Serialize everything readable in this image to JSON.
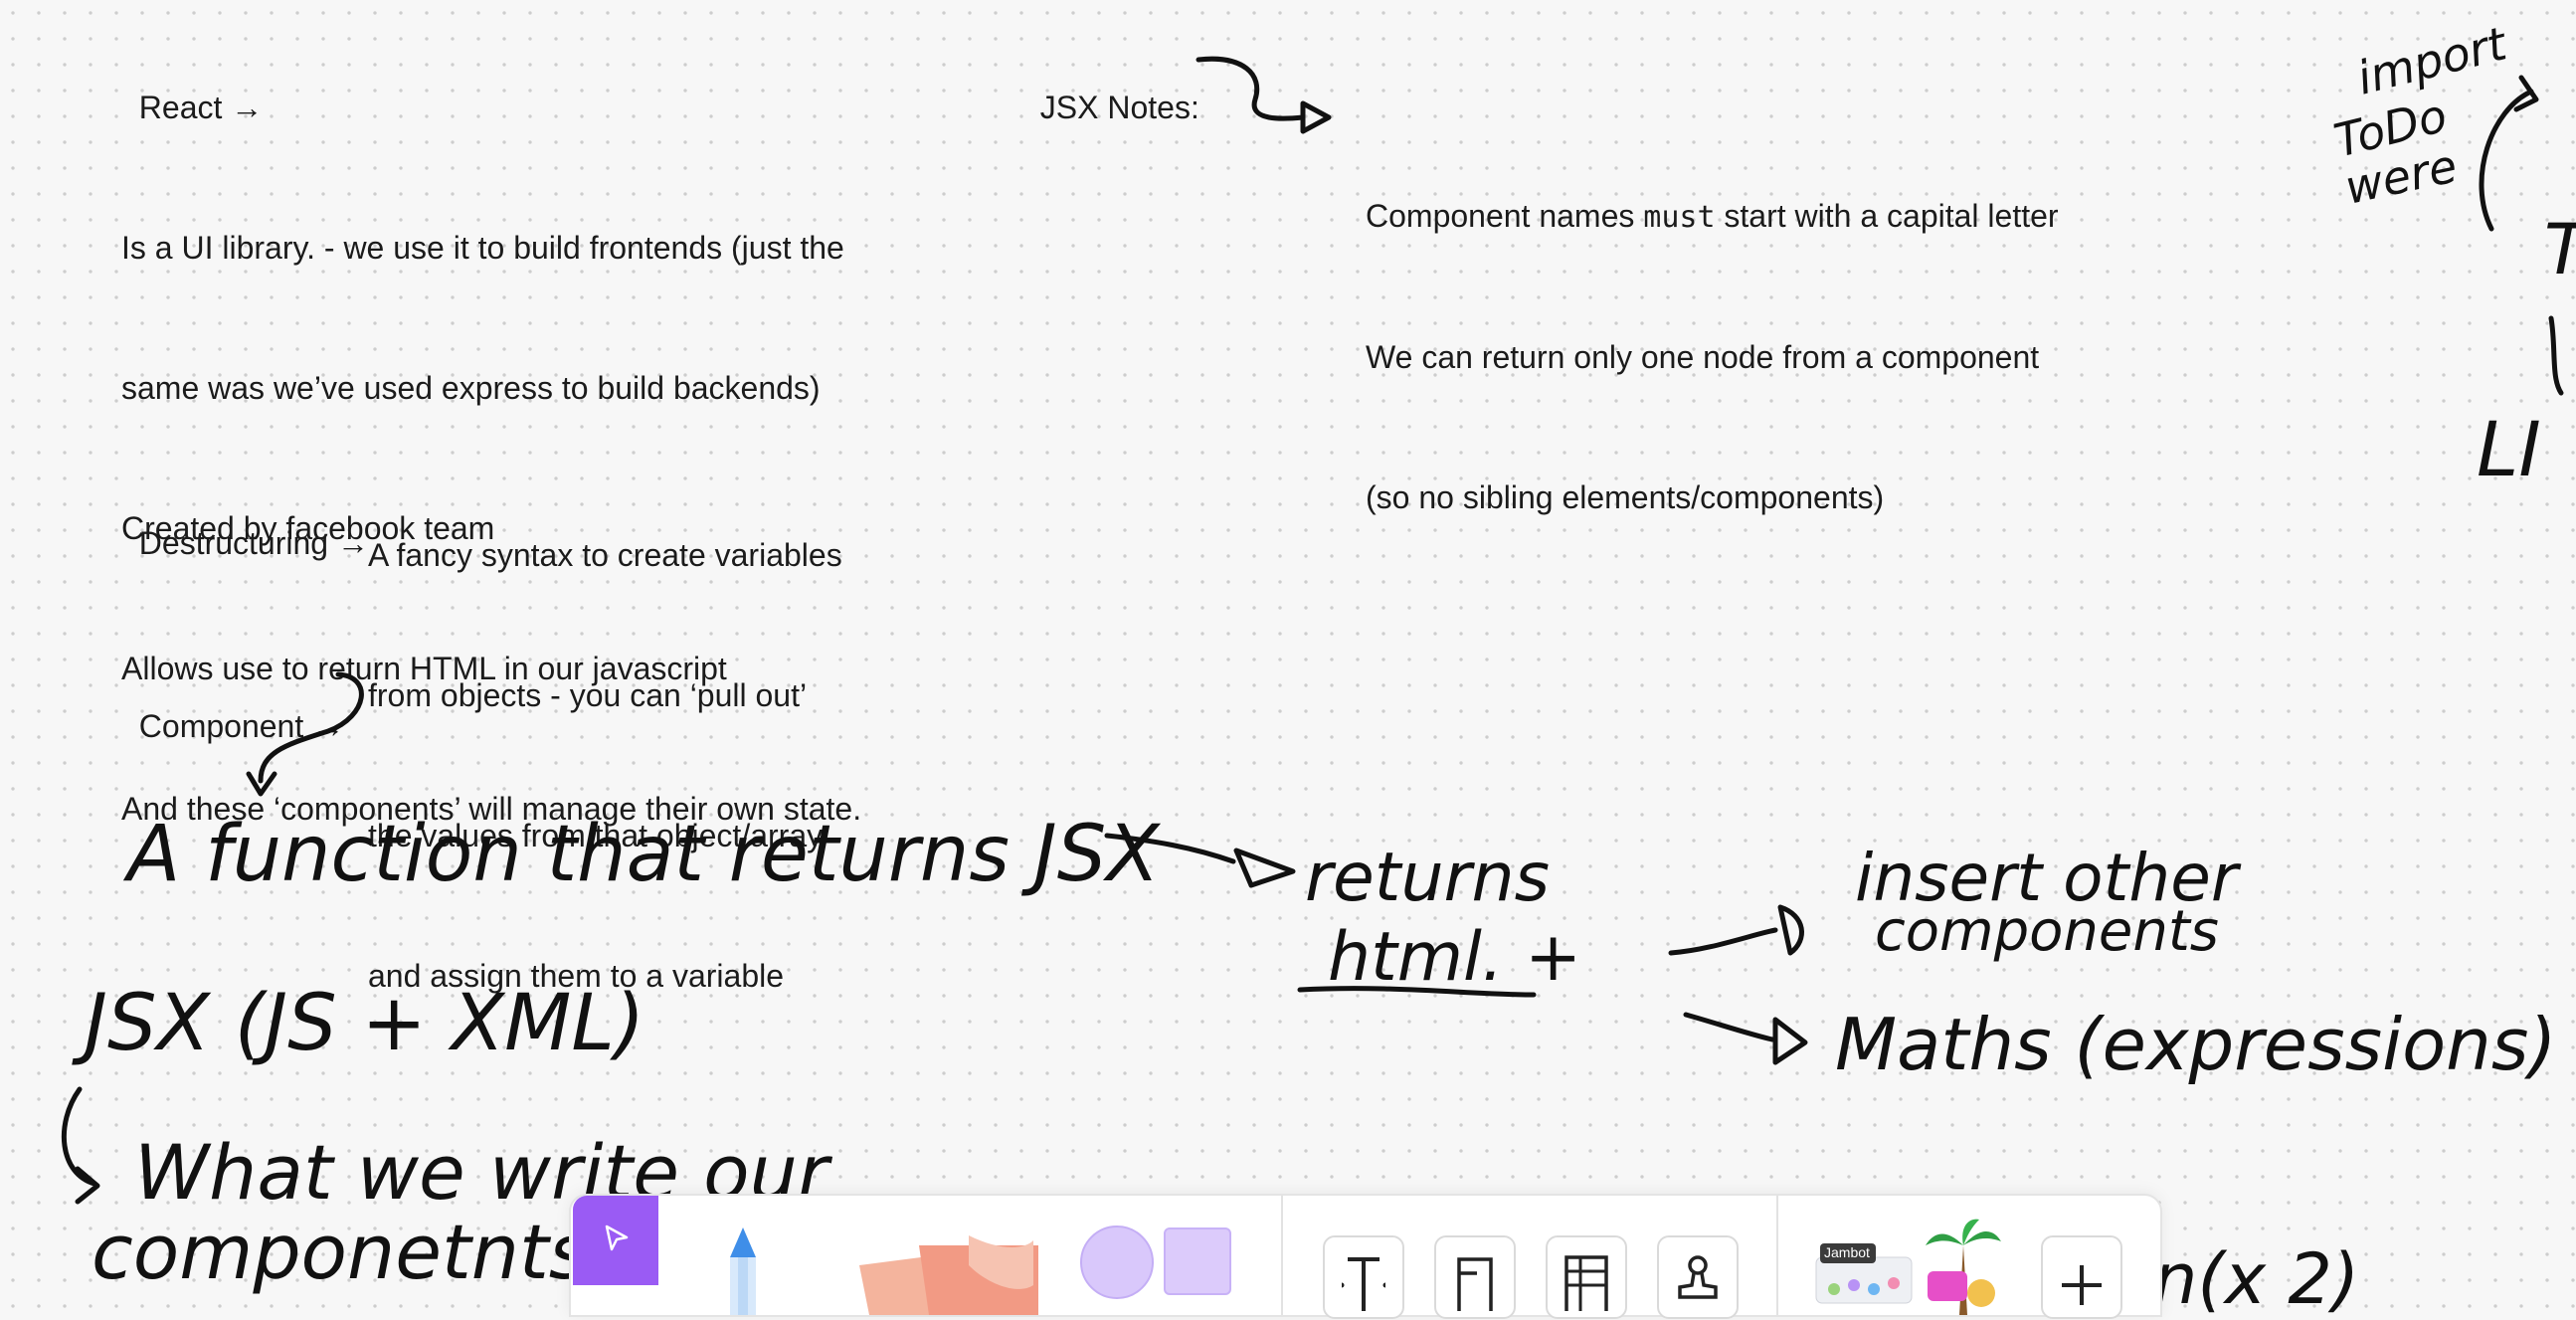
{
  "notes": {
    "react": {
      "title": "React →",
      "lines": [
        "Is a UI library. - we use it to build frontends (just the",
        "same was we’ve used express to build backends)",
        "Created by facebook team",
        "Allows use to return HTML in our javascript",
        "And these ‘components’ will manage their own state."
      ]
    },
    "destructuring": {
      "title": "Destructuring →",
      "lines": [
        "A fancy syntax to create variables",
        "from objects - you can ‘pull out’",
        "the values from that object/array",
        "and assign them to a variable"
      ]
    },
    "component": {
      "title": "Component →"
    },
    "jsx_notes": {
      "title": "JSX Notes:",
      "line1_before": "Component names ",
      "line1_code": "must",
      "line1_after": " start with a capital letter",
      "line2": "We can return only one node from a component",
      "line3": "(so no sibling elements/components)"
    }
  },
  "handwriting": {
    "function_jsx": "A function that returns JSX",
    "returns_html": "returns html +",
    "insert_other": "insert other components",
    "maths": "Maths (expressions)",
    "jsx_def": "JSX (JS + XML)",
    "what_we_write": "What we write our componetnts.",
    "import_todo": "import ToDo were",
    "partial_t": "T",
    "partial_li": "LI",
    "partial_bottom": "n(x 2)"
  },
  "toolbar": {
    "tools": [
      {
        "name": "select",
        "icon": "cursor-arrow-icon",
        "active": true
      },
      {
        "name": "pen",
        "icon": "pen-icon"
      },
      {
        "name": "sticky-notes",
        "icon": "sticky-note-icon"
      },
      {
        "name": "circle",
        "icon": "circle-shape-icon"
      },
      {
        "name": "rectangle",
        "icon": "rectangle-shape-icon"
      },
      {
        "name": "text",
        "icon": "text-icon"
      },
      {
        "name": "section",
        "icon": "section-icon"
      },
      {
        "name": "table",
        "icon": "table-icon"
      },
      {
        "name": "stamp",
        "icon": "stamp-icon"
      },
      {
        "name": "more",
        "icon": "plus-icon"
      }
    ],
    "jambot_label": "Jambot",
    "accent_color": "#9a5bf4"
  }
}
